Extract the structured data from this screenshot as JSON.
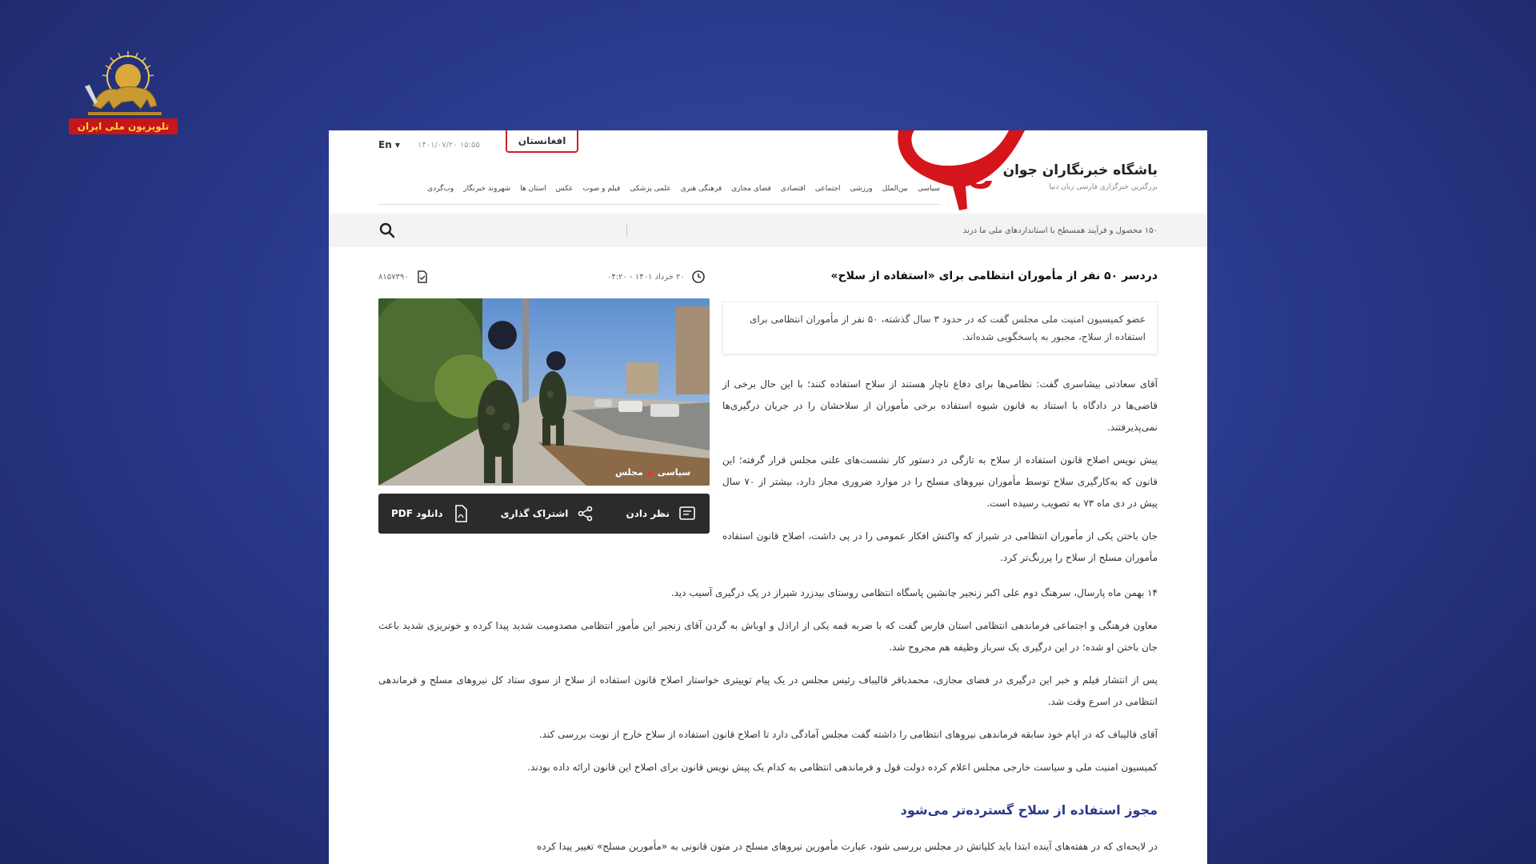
{
  "channel": {
    "logo_banner": "تلویزیون ملی ایران",
    "banner_color": "#c7161b"
  },
  "site": {
    "name": "باشگاه خبرنگاران جوان",
    "subtitle": "بزرگترین خبرگزاری فارسی زبان دنیا",
    "lang_label": "En",
    "top_date": "۱۴۰۱/۰۷/۲۰   ۱۵:۵۵",
    "region_tab": "افغانستان",
    "brand_color": "#d4151b",
    "nav_items": [
      "سیاسی",
      "بین‌الملل",
      "ورزشی",
      "اجتماعی",
      "اقتصادی",
      "فضای مجازی",
      "فرهنگی هنری",
      "علمی پزشکی",
      "فیلم و صوت",
      "عکس",
      "استان ها",
      "شهروند خبرنگار",
      "وب‌گردی"
    ],
    "ticker": "۱۵۰ محصول و فرآیند همسطح با استانداردهای ملی ما درند",
    "search_icon": "search-icon"
  },
  "article": {
    "title": "دردسر ۵۰ نفر از مأموران انتظامی برای «استفاده از سلاح»",
    "time": "۲۰ خرداد ۱۴۰۱ - ۰۴:۲۰",
    "id": "۸۱۵۷۳۹۰",
    "photo_tag": "سیاسی",
    "photo_tag2": "مجلس",
    "lead": "عضو کمیسیون امنیت ملی مجلس گفت که در حدود ۳ سال گذشته، ۵۰ نفر از مأموران انتظامی برای استفاده از سلاح، مجبور به پاسخگویی شده‌اند.",
    "actions": {
      "comment": "نظر دادن",
      "share": "اشتراک گذاری",
      "pdf": "دانلود PDF"
    },
    "paragraphs_side": [
      "آقای سعادتی بیشاسری گفت: نظامی‌ها برای دفاع ناچار هستند از سلاح استفاده کنند؛ با این حال برخی از قاضی‌ها در دادگاه با استناد به قانون شیوه استفاده برخی مأموران از سلاحشان را در جریان درگیری‌ها نمی‌پذیرفتند.",
      "پیش نویس اصلاح قانون استفاده از سلاح به تازگی در دستور کار نشست‌های علنی مجلس قرار گرفته؛ این قانون که به‌کارگیری سلاح توسط مأموران نیروهای مسلح را در موارد ضروری مجاز دارد، بیشتر از ۷۰ سال پیش در دی ماه ۷۳ به تصویب رسیده است.",
      "جان باختن یکی از مأموران انتظامی در شیراز که واکنش افکار عمومی را در پی داشت، اصلاح قانون استفاده مأموران مسلح از سلاح را پررنگ‌تر کرد."
    ],
    "paragraphs_full": [
      "۱۴ بهمن ماه پارسال، سرهنگ دوم علی اکبر زنجیر چانشین پاسگاه انتظامی روستای بیدزرد شیراز در یک درگیری آسیب دید.",
      "معاون فرهنگی و اجتماعی فرماندهی انتظامی استان فارس گفت که با ضربه قمه یکی از اراذل و اوباش به گردن آقای زنجیر این مأمور انتظامی مصدومیت شدید پیدا کرده و خونریزی شدید باعث جان باختن او شده؛ در این درگیری یک سرباز وظیفه هم مجروح شد.",
      "پس از انتشار فیلم و خبر این درگیری در فضای مجازی، محمدباقر قالیباف رئیس مجلس در یک پیام توییتری خواستار اصلاح قانون استفاده از سلاح از سوی ستاد کل نیروهای مسلح و فرماندهی انتظامی در اسرع وقت شد.",
      "آقای قالیباف که در ایام خود سابقه فرماندهی نیروهای انتظامی را داشته گفت مجلس آمادگی دارد تا اصلاح قانون استفاده از سلاح خارج از نوبت بررسی کند.",
      "کمیسیون امنیت ملی و سیاست خارجی مجلس اعلام کرده دولت قول و فرماندهی انتظامی به کدام یک پیش نویس قانون برای اصلاح این قانون ارائه داده بودند."
    ],
    "section_heading": "مجوز استفاده از سلاح گسترده‌تر می‌شود",
    "paragraph_last": "در لایحه‌ای که در هفته‌های آینده ابتدا باید کلیاتش در مجلس بررسی شود، عبارت مأمورین نیروهای مسلح در متون قانونی به «مأمورین مسلح» تغییر پیدا کرده"
  }
}
